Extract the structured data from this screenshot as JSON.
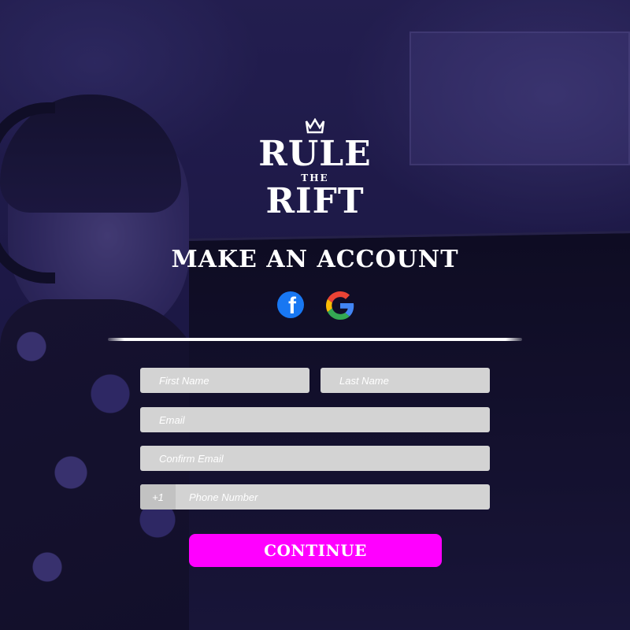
{
  "brand": {
    "line1": "RULE",
    "line2": "THE",
    "line3": "RIFT",
    "crown_icon": "crown-icon"
  },
  "heading": "MAKE AN ACCOUNT",
  "social": {
    "facebook": {
      "icon": "facebook-icon",
      "glyph": "f",
      "color": "#1877f2"
    },
    "google": {
      "icon": "google-icon",
      "colors": [
        "#4285F4",
        "#EA4335",
        "#FBBC05",
        "#34A853"
      ]
    }
  },
  "form": {
    "first_name_placeholder": "First Name",
    "last_name_placeholder": "Last Name",
    "email_placeholder": "Email",
    "confirm_email_placeholder": "Confirm Email",
    "phone_country_code": "+1",
    "phone_placeholder": "Phone Number"
  },
  "continue_label": "CONTINUE",
  "colors": {
    "accent": "#ff00ff",
    "field_bg": "#d3d3d3",
    "background": "#221d52"
  }
}
